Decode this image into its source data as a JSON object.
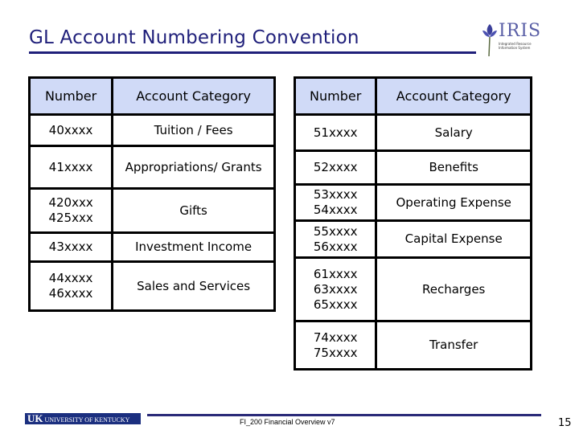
{
  "title": "GL Account Numbering Convention",
  "logo": {
    "name": "IRIS",
    "subtitle": "Integrated Resource Information System"
  },
  "left_table": {
    "headers": [
      "Number",
      "Account Category"
    ],
    "rows": [
      {
        "number": "40xxxx",
        "category": "Tuition / Fees"
      },
      {
        "number": "41xxxx",
        "category": "Appropriations/ Grants"
      },
      {
        "number": "420xxx\n425xxx",
        "category": "Gifts"
      },
      {
        "number": "43xxxx",
        "category": "Investment Income"
      },
      {
        "number": "44xxxx\n46xxxx",
        "category": "Sales and Services"
      }
    ]
  },
  "right_table": {
    "headers": [
      "Number",
      "Account Category"
    ],
    "rows": [
      {
        "number": "51xxxx",
        "category": "Salary"
      },
      {
        "number": "52xxxx",
        "category": "Benefits"
      },
      {
        "number": "53xxxx\n54xxxx",
        "category": "Operating Expense"
      },
      {
        "number": "55xxxx\n56xxxx",
        "category": "Capital Expense"
      },
      {
        "number": "61xxxx\n63xxxx\n65xxxx",
        "category": "Recharges"
      },
      {
        "number": "74xxxx\n75xxxx",
        "category": "Transfer"
      }
    ]
  },
  "footer": {
    "university": "UNIVERSITY OF KENTUCKY",
    "university_mark": "UK",
    "course": "FI_200 Financial Overview v7",
    "page_number": "15"
  }
}
